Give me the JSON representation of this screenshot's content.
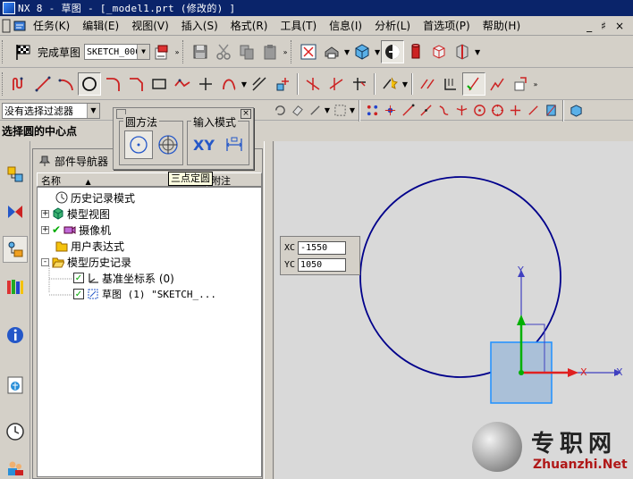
{
  "window": {
    "title": "NX 8 - 草图 - [_model1.prt (修改的) ]",
    "controls": [
      "_",
      "♯",
      "×"
    ]
  },
  "menubar": {
    "items": [
      {
        "label": "任务(K)",
        "icon": "task-icon"
      },
      {
        "label": "编辑(E)"
      },
      {
        "label": "视图(V)"
      },
      {
        "label": "插入(S)"
      },
      {
        "label": "格式(R)"
      },
      {
        "label": "工具(T)"
      },
      {
        "label": "信息(I)"
      },
      {
        "label": "分析(L)"
      },
      {
        "label": "首选项(P)"
      },
      {
        "label": "帮助(H)"
      }
    ]
  },
  "toolbar": {
    "finish_sketch_label": "完成草图",
    "sketch_name": "SKETCH_000",
    "selection_filter": "没有选择过滤器"
  },
  "cue_line": "选择圆的中心点",
  "navigator": {
    "title": "部件导航器",
    "columns": [
      "名称",
      "附注"
    ],
    "nodes": [
      {
        "label": "历史记录模式",
        "icon": "clock-icon",
        "expand": ""
      },
      {
        "label": "模型视图",
        "icon": "model-views-icon",
        "expand": "+"
      },
      {
        "label": "摄像机",
        "icon": "camera-icon",
        "expand": "+"
      },
      {
        "label": "用户表达式",
        "icon": "folder-icon",
        "expand": ""
      },
      {
        "label": "模型历史记录",
        "icon": "folder-open-icon",
        "expand": "-"
      },
      {
        "label": "基准坐标系 (0)",
        "icon": "datum-csys-icon",
        "checked": true
      },
      {
        "label": "草图 (1) \"SKETCH_...",
        "icon": "sketch-icon",
        "checked": true
      }
    ]
  },
  "circle_popup": {
    "method_group": "圆方法",
    "input_group": "输入模式",
    "xy_label": "XY",
    "tooltip": "三点定圆"
  },
  "coordinate_input": {
    "xc_label": "XC",
    "xc_value": "-1550",
    "yc_label": "YC",
    "yc_value": "1050"
  },
  "graphics": {
    "axis_labels": {
      "y": "Y",
      "x": "X"
    },
    "colors": {
      "circle": "#00008b",
      "y_axis": "#4040c0",
      "x_axis": "#4040c0",
      "z_axis": "#00b000",
      "x_red": "#e02020",
      "csys_square": "#1e90ff"
    }
  },
  "watermark": {
    "cn": "专职网",
    "en": "Zhuanzhi.Net"
  }
}
